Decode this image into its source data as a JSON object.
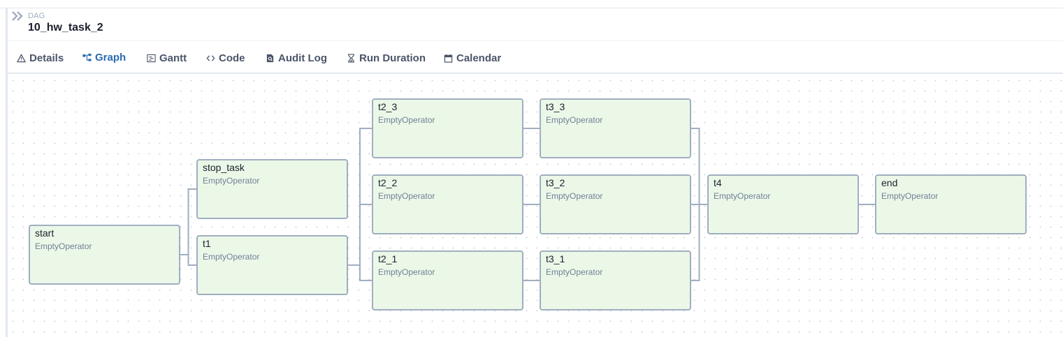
{
  "header": {
    "collapse_icon": "chevron-double-right-icon",
    "label": "DAG",
    "title": "10_hw_task_2"
  },
  "tabs": [
    {
      "label": "Details",
      "icon": "warning-triangle-icon",
      "active": false
    },
    {
      "label": "Graph",
      "icon": "graph-nodes-icon",
      "active": true
    },
    {
      "label": "Gantt",
      "icon": "gantt-chart-icon",
      "active": false
    },
    {
      "label": "Code",
      "icon": "code-brackets-icon",
      "active": false
    },
    {
      "label": "Audit Log",
      "icon": "document-search-icon",
      "active": false
    },
    {
      "label": "Run Duration",
      "icon": "hourglass-icon",
      "active": false
    },
    {
      "label": "Calendar",
      "icon": "calendar-icon",
      "active": false
    }
  ],
  "graph": {
    "nodes": [
      {
        "id": "start",
        "operator": "EmptyOperator"
      },
      {
        "id": "stop_task",
        "operator": "EmptyOperator"
      },
      {
        "id": "t1",
        "operator": "EmptyOperator"
      },
      {
        "id": "t2_3",
        "operator": "EmptyOperator"
      },
      {
        "id": "t2_2",
        "operator": "EmptyOperator"
      },
      {
        "id": "t2_1",
        "operator": "EmptyOperator"
      },
      {
        "id": "t3_3",
        "operator": "EmptyOperator"
      },
      {
        "id": "t3_2",
        "operator": "EmptyOperator"
      },
      {
        "id": "t3_1",
        "operator": "EmptyOperator"
      },
      {
        "id": "t4",
        "operator": "EmptyOperator"
      },
      {
        "id": "end",
        "operator": "EmptyOperator"
      }
    ],
    "edges": [
      [
        "start",
        "stop_task"
      ],
      [
        "start",
        "t1"
      ],
      [
        "t1",
        "t2_3"
      ],
      [
        "t1",
        "t2_2"
      ],
      [
        "t1",
        "t2_1"
      ],
      [
        "t2_3",
        "t3_3"
      ],
      [
        "t2_2",
        "t3_2"
      ],
      [
        "t2_1",
        "t3_1"
      ],
      [
        "t3_3",
        "t4"
      ],
      [
        "t3_2",
        "t4"
      ],
      [
        "t3_1",
        "t4"
      ],
      [
        "t4",
        "end"
      ]
    ],
    "colors": {
      "node_fill": "#ebf8e8",
      "node_border": "#a0aec0",
      "edge": "#a0aec0",
      "active_tab": "#2b6cb0"
    }
  }
}
